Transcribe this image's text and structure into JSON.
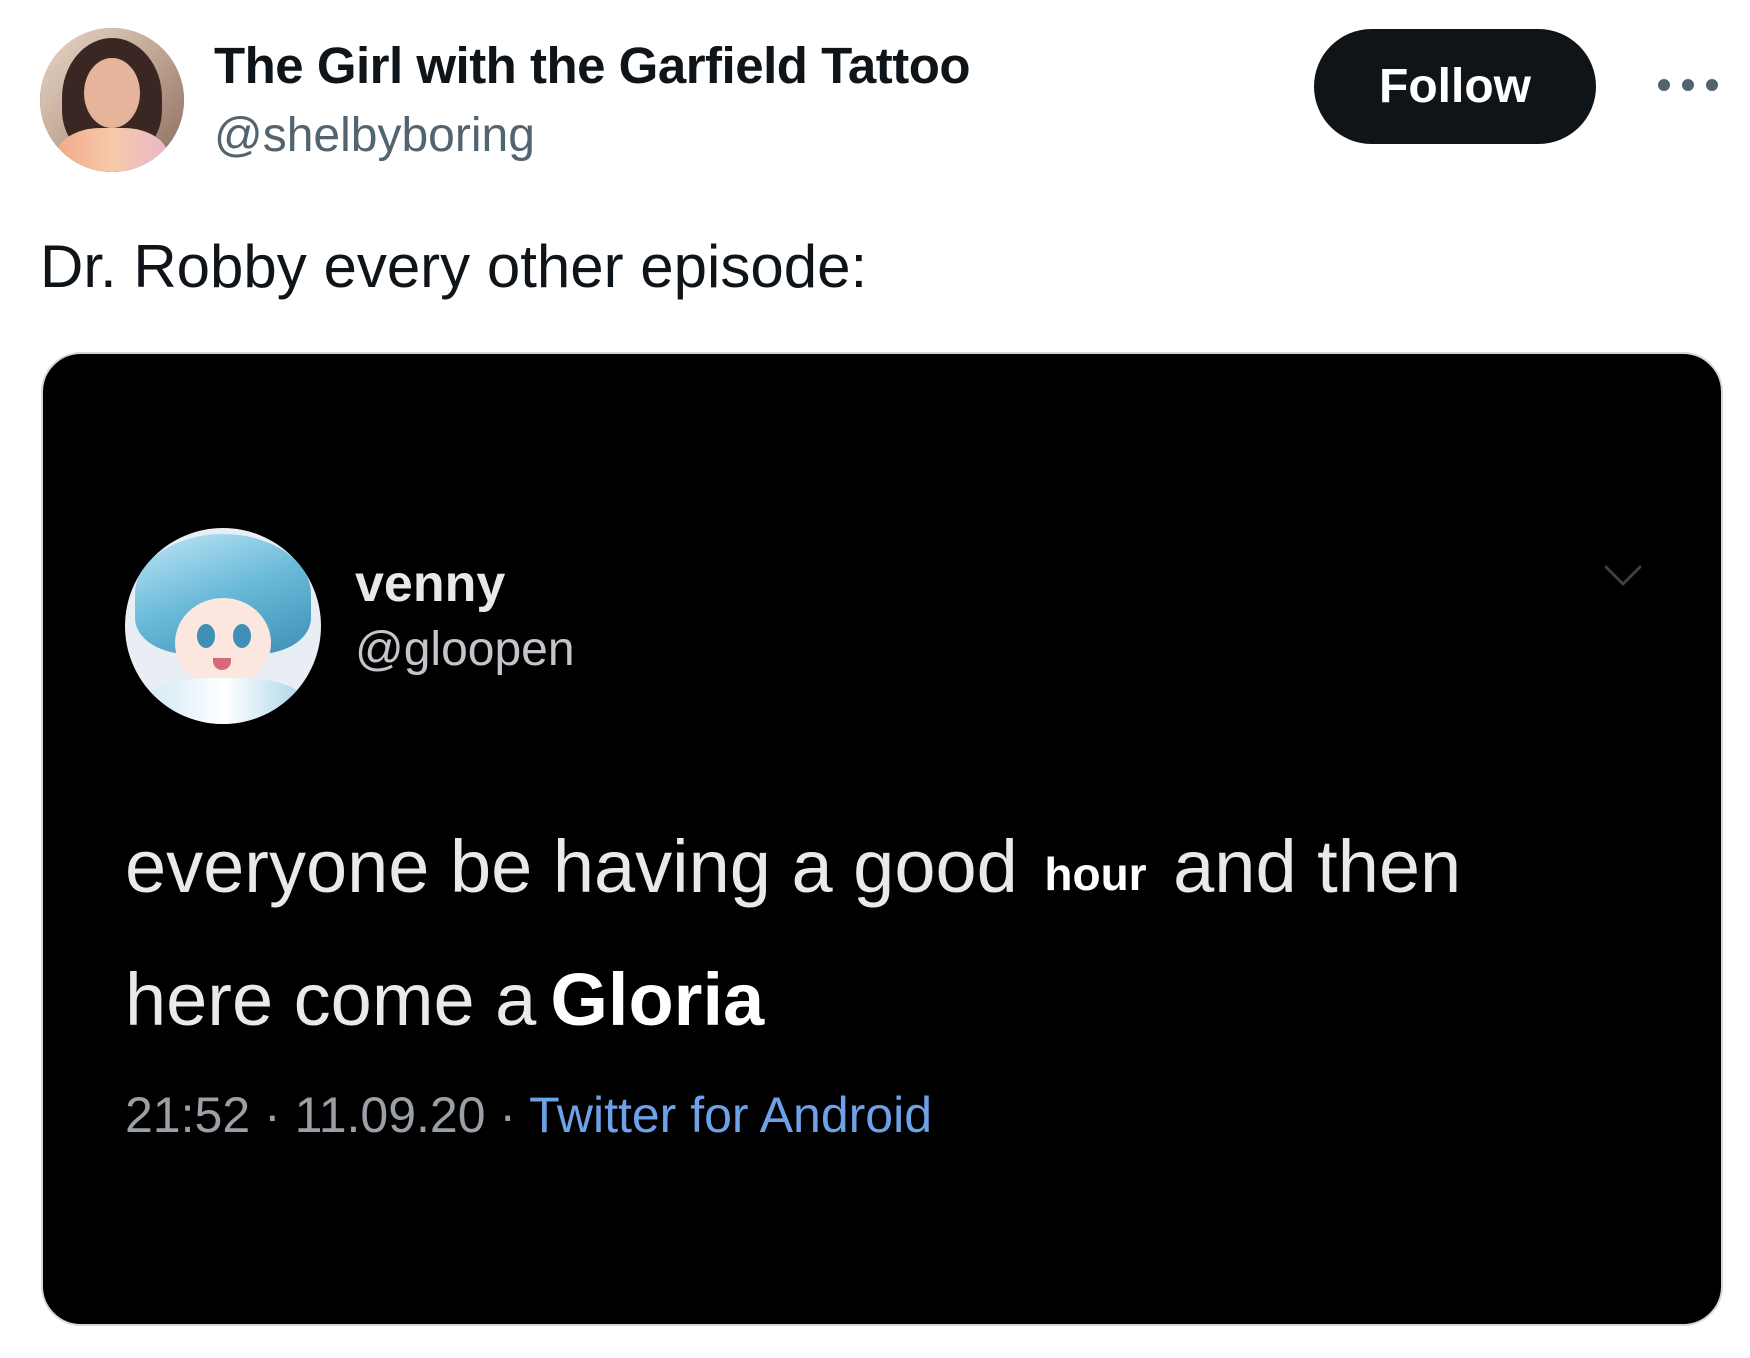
{
  "tweet": {
    "author": {
      "display_name": "The Girl with the Garfield Tattoo",
      "handle": "@shelbyboring"
    },
    "follow_label": "Follow",
    "more_icon": "more-horizontal-icon",
    "text": "Dr. Robby every other episode:"
  },
  "embedded_tweet": {
    "author": {
      "display_name": "venny",
      "handle": "@gloopen"
    },
    "chevron_icon": "chevron-down-icon",
    "text_line1_a": "everyone be having a good",
    "text_line1_hour": "hour",
    "text_line1_b": "and then",
    "text_line2_a": "here come a",
    "text_line2_gloria": "Gloria",
    "time": "21:52",
    "date": "11.09.20",
    "separator": "·",
    "source": "Twitter for Android"
  },
  "colors": {
    "text_primary": "#0f1419",
    "text_secondary": "#536471",
    "follow_bg": "#0f1419",
    "media_bg": "#000000",
    "source_link": "#6ea2e8"
  }
}
